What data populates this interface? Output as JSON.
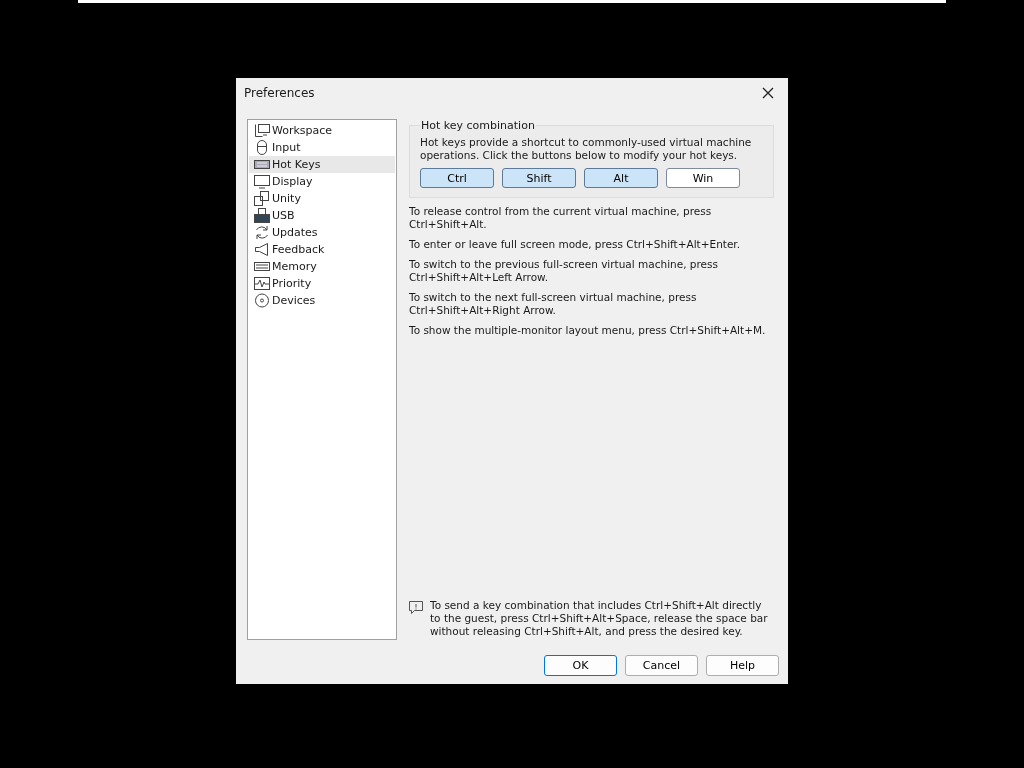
{
  "window": {
    "title": "Preferences"
  },
  "sidebar": {
    "items": [
      {
        "label": "Workspace",
        "selected": false
      },
      {
        "label": "Input",
        "selected": false
      },
      {
        "label": "Hot Keys",
        "selected": true
      },
      {
        "label": "Display",
        "selected": false
      },
      {
        "label": "Unity",
        "selected": false
      },
      {
        "label": "USB",
        "selected": false
      },
      {
        "label": "Updates",
        "selected": false
      },
      {
        "label": "Feedback",
        "selected": false
      },
      {
        "label": "Memory",
        "selected": false
      },
      {
        "label": "Priority",
        "selected": false
      },
      {
        "label": "Devices",
        "selected": false
      }
    ]
  },
  "hotkey_group": {
    "title": "Hot key combination",
    "description": "Hot keys provide a shortcut to commonly-used virtual machine operations. Click the buttons below to modify your hot keys.",
    "keys": [
      {
        "label": "Ctrl",
        "selected": true
      },
      {
        "label": "Shift",
        "selected": true
      },
      {
        "label": "Alt",
        "selected": true
      },
      {
        "label": "Win",
        "selected": false
      }
    ]
  },
  "instructions": [
    "To release control from the current virtual machine, press Ctrl+Shift+Alt.",
    "To enter or leave full screen mode, press Ctrl+Shift+Alt+Enter.",
    "To switch to the previous full-screen virtual machine, press Ctrl+Shift+Alt+Left Arrow.",
    "To switch to the next full-screen virtual machine, press Ctrl+Shift+Alt+Right Arrow.",
    "To show the multiple-monitor layout menu, press Ctrl+Shift+Alt+M."
  ],
  "note": "To send a key combination that includes Ctrl+Shift+Alt directly to the guest, press Ctrl+Shift+Alt+Space, release the space bar without releasing Ctrl+Shift+Alt, and press the desired key.",
  "buttons": [
    "OK",
    "Cancel",
    "Help"
  ]
}
